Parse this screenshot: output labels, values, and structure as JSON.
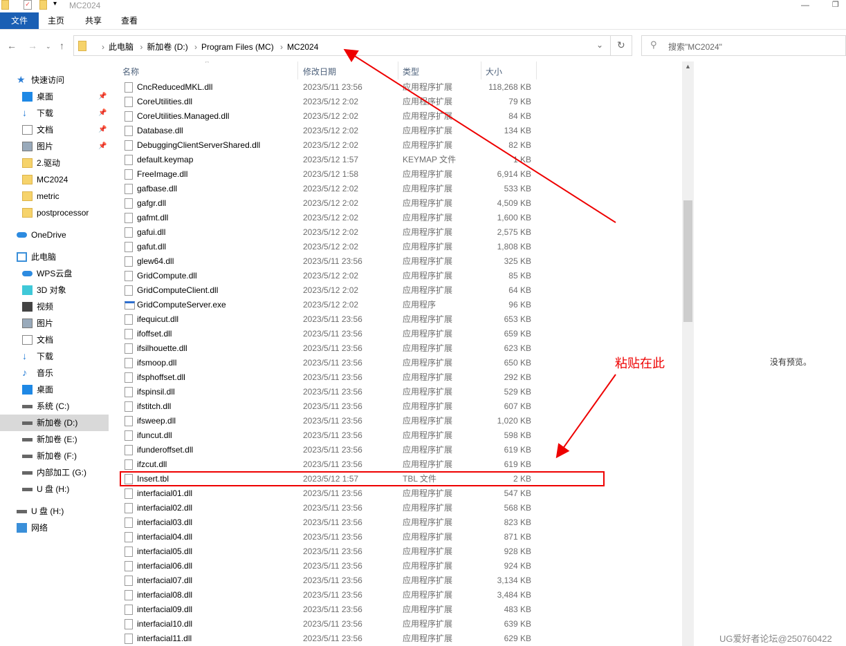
{
  "window": {
    "title": "MC2024"
  },
  "ribbon": {
    "tabs": [
      "文件",
      "主页",
      "共享",
      "查看"
    ]
  },
  "address": {
    "crumbs": [
      "此电脑",
      "新加卷 (D:)",
      "Program Files (MC)",
      "MC2024"
    ]
  },
  "search": {
    "placeholder": "搜索\"MC2024\""
  },
  "sidebar": [
    {
      "label": "快速访问",
      "icon": "star-icon",
      "lvl": 0,
      "pin": false
    },
    {
      "label": "桌面",
      "icon": "desktop-icon",
      "lvl": 1,
      "pin": true
    },
    {
      "label": "下载",
      "icon": "download-icon",
      "lvl": 1,
      "pin": true
    },
    {
      "label": "文档",
      "icon": "document-icon",
      "lvl": 1,
      "pin": true
    },
    {
      "label": "图片",
      "icon": "pictures-icon",
      "lvl": 1,
      "pin": true
    },
    {
      "label": "2.驱动",
      "icon": "folder-icon",
      "lvl": 1
    },
    {
      "label": "MC2024",
      "icon": "folder-icon",
      "lvl": 1
    },
    {
      "label": "metric",
      "icon": "folder-icon",
      "lvl": 1
    },
    {
      "label": "postprocessor",
      "icon": "folder-icon",
      "lvl": 1
    },
    {
      "label": "OneDrive",
      "icon": "cloud-icon",
      "lvl": 0,
      "gap": true
    },
    {
      "label": "此电脑",
      "icon": "computer-icon",
      "lvl": 0,
      "gap": true
    },
    {
      "label": "WPS云盘",
      "icon": "cloud-icon",
      "lvl": 1
    },
    {
      "label": "3D 对象",
      "icon": "cube-icon",
      "lvl": 1
    },
    {
      "label": "视频",
      "icon": "video-icon",
      "lvl": 1
    },
    {
      "label": "图片",
      "icon": "pictures-icon",
      "lvl": 1
    },
    {
      "label": "文档",
      "icon": "document-icon",
      "lvl": 1
    },
    {
      "label": "下载",
      "icon": "download-icon",
      "lvl": 1
    },
    {
      "label": "音乐",
      "icon": "music-icon",
      "lvl": 1
    },
    {
      "label": "桌面",
      "icon": "desktop-icon",
      "lvl": 1
    },
    {
      "label": "系统 (C:)",
      "icon": "drive-icon",
      "lvl": 1
    },
    {
      "label": "新加卷 (D:)",
      "icon": "drive-icon",
      "lvl": 1,
      "selected": true
    },
    {
      "label": "新加卷 (E:)",
      "icon": "drive-icon",
      "lvl": 1
    },
    {
      "label": "新加卷 (F:)",
      "icon": "drive-icon",
      "lvl": 1
    },
    {
      "label": "内部加工 (G:)",
      "icon": "drive-icon",
      "lvl": 1
    },
    {
      "label": "U 盘 (H:)",
      "icon": "drive-icon",
      "lvl": 1
    },
    {
      "label": "U 盘 (H:)",
      "icon": "drive-icon",
      "lvl": 0,
      "gap": true
    },
    {
      "label": "网络",
      "icon": "network-icon",
      "lvl": 0
    }
  ],
  "columns": [
    "名称",
    "修改日期",
    "类型",
    "大小"
  ],
  "files": [
    [
      "CncReducedMKL.dll",
      "2023/5/11 23:56",
      "应用程序扩展",
      "118,268 KB"
    ],
    [
      "CoreUtilities.dll",
      "2023/5/12 2:02",
      "应用程序扩展",
      "79 KB"
    ],
    [
      "CoreUtilities.Managed.dll",
      "2023/5/12 2:02",
      "应用程序扩展",
      "84 KB"
    ],
    [
      "Database.dll",
      "2023/5/12 2:02",
      "应用程序扩展",
      "134 KB"
    ],
    [
      "DebuggingClientServerShared.dll",
      "2023/5/12 2:02",
      "应用程序扩展",
      "82 KB"
    ],
    [
      "default.keymap",
      "2023/5/12 1:57",
      "KEYMAP 文件",
      "1 KB"
    ],
    [
      "FreeImage.dll",
      "2023/5/12 1:58",
      "应用程序扩展",
      "6,914 KB"
    ],
    [
      "gafbase.dll",
      "2023/5/12 2:02",
      "应用程序扩展",
      "533 KB"
    ],
    [
      "gafgr.dll",
      "2023/5/12 2:02",
      "应用程序扩展",
      "4,509 KB"
    ],
    [
      "gafmt.dll",
      "2023/5/12 2:02",
      "应用程序扩展",
      "1,600 KB"
    ],
    [
      "gafui.dll",
      "2023/5/12 2:02",
      "应用程序扩展",
      "2,575 KB"
    ],
    [
      "gafut.dll",
      "2023/5/12 2:02",
      "应用程序扩展",
      "1,808 KB"
    ],
    [
      "glew64.dll",
      "2023/5/11 23:56",
      "应用程序扩展",
      "325 KB"
    ],
    [
      "GridCompute.dll",
      "2023/5/12 2:02",
      "应用程序扩展",
      "85 KB"
    ],
    [
      "GridComputeClient.dll",
      "2023/5/12 2:02",
      "应用程序扩展",
      "64 KB"
    ],
    [
      "GridComputeServer.exe",
      "2023/5/12 2:02",
      "应用程序",
      "96 KB"
    ],
    [
      "ifequicut.dll",
      "2023/5/11 23:56",
      "应用程序扩展",
      "653 KB"
    ],
    [
      "ifoffset.dll",
      "2023/5/11 23:56",
      "应用程序扩展",
      "659 KB"
    ],
    [
      "ifsilhouette.dll",
      "2023/5/11 23:56",
      "应用程序扩展",
      "623 KB"
    ],
    [
      "ifsmoop.dll",
      "2023/5/11 23:56",
      "应用程序扩展",
      "650 KB"
    ],
    [
      "ifsphoffset.dll",
      "2023/5/11 23:56",
      "应用程序扩展",
      "292 KB"
    ],
    [
      "ifspinsil.dll",
      "2023/5/11 23:56",
      "应用程序扩展",
      "529 KB"
    ],
    [
      "ifstitch.dll",
      "2023/5/11 23:56",
      "应用程序扩展",
      "607 KB"
    ],
    [
      "ifsweep.dll",
      "2023/5/11 23:56",
      "应用程序扩展",
      "1,020 KB"
    ],
    [
      "ifuncut.dll",
      "2023/5/11 23:56",
      "应用程序扩展",
      "598 KB"
    ],
    [
      "ifunderoffset.dll",
      "2023/5/11 23:56",
      "应用程序扩展",
      "619 KB"
    ],
    [
      "ifzcut.dll",
      "2023/5/11 23:56",
      "应用程序扩展",
      "619 KB"
    ],
    [
      "Insert.tbl",
      "2023/5/12 1:57",
      "TBL 文件",
      "2 KB"
    ],
    [
      "interfacial01.dll",
      "2023/5/11 23:56",
      "应用程序扩展",
      "547 KB"
    ],
    [
      "interfacial02.dll",
      "2023/5/11 23:56",
      "应用程序扩展",
      "568 KB"
    ],
    [
      "interfacial03.dll",
      "2023/5/11 23:56",
      "应用程序扩展",
      "823 KB"
    ],
    [
      "interfacial04.dll",
      "2023/5/11 23:56",
      "应用程序扩展",
      "871 KB"
    ],
    [
      "interfacial05.dll",
      "2023/5/11 23:56",
      "应用程序扩展",
      "928 KB"
    ],
    [
      "interfacial06.dll",
      "2023/5/11 23:56",
      "应用程序扩展",
      "924 KB"
    ],
    [
      "interfacial07.dll",
      "2023/5/11 23:56",
      "应用程序扩展",
      "3,134 KB"
    ],
    [
      "interfacial08.dll",
      "2023/5/11 23:56",
      "应用程序扩展",
      "3,484 KB"
    ],
    [
      "interfacial09.dll",
      "2023/5/11 23:56",
      "应用程序扩展",
      "483 KB"
    ],
    [
      "interfacial10.dll",
      "2023/5/11 23:56",
      "应用程序扩展",
      "639 KB"
    ],
    [
      "interfacial11.dll",
      "2023/5/11 23:56",
      "应用程序扩展",
      "629 KB"
    ]
  ],
  "preview": {
    "text": "没有预览。"
  },
  "annotation": {
    "label": "粘贴在此",
    "color": "#e00000"
  },
  "watermark": "UG爱好者论坛@250760422"
}
